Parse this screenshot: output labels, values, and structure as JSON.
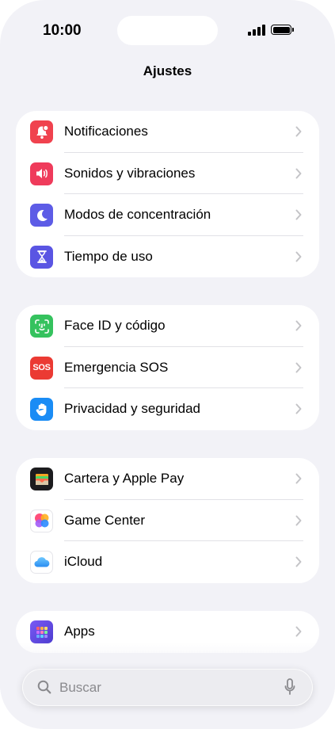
{
  "status_bar": {
    "time": "10:00"
  },
  "nav": {
    "title": "Ajustes"
  },
  "groups": [
    {
      "items": [
        {
          "label": "Notificaciones",
          "icon": "bell-badge-icon",
          "color": "#f0424e"
        },
        {
          "label": "Sonidos y vibraciones",
          "icon": "speaker-wave-icon",
          "color": "#ef3b5b"
        },
        {
          "label": "Modos de concentración",
          "icon": "moon-icon",
          "color": "#5d5ce6"
        },
        {
          "label": "Tiempo de uso",
          "icon": "hourglass-icon",
          "color": "#5a55e3"
        }
      ]
    },
    {
      "items": [
        {
          "label": "Face ID y código",
          "icon": "face-id-icon",
          "color": "#35c25e"
        },
        {
          "label": "Emergencia SOS",
          "icon": "sos-icon",
          "icon_text": "SOS",
          "color": "#eb3a33"
        },
        {
          "label": "Privacidad y seguridad",
          "icon": "hand-icon",
          "color": "#1a8cf5"
        }
      ]
    },
    {
      "items": [
        {
          "label": "Cartera y Apple Pay",
          "icon": "wallet-icon",
          "color": "#1c1c1e"
        },
        {
          "label": "Game Center",
          "icon": "game-center-icon",
          "color": "#ffffff"
        },
        {
          "label": "iCloud",
          "icon": "cloud-icon",
          "color": "#ffffff"
        }
      ]
    },
    {
      "items": [
        {
          "label": "Apps",
          "icon": "apps-grid-icon",
          "color": "#6c4ce0"
        }
      ]
    }
  ],
  "search": {
    "placeholder": "Buscar"
  }
}
